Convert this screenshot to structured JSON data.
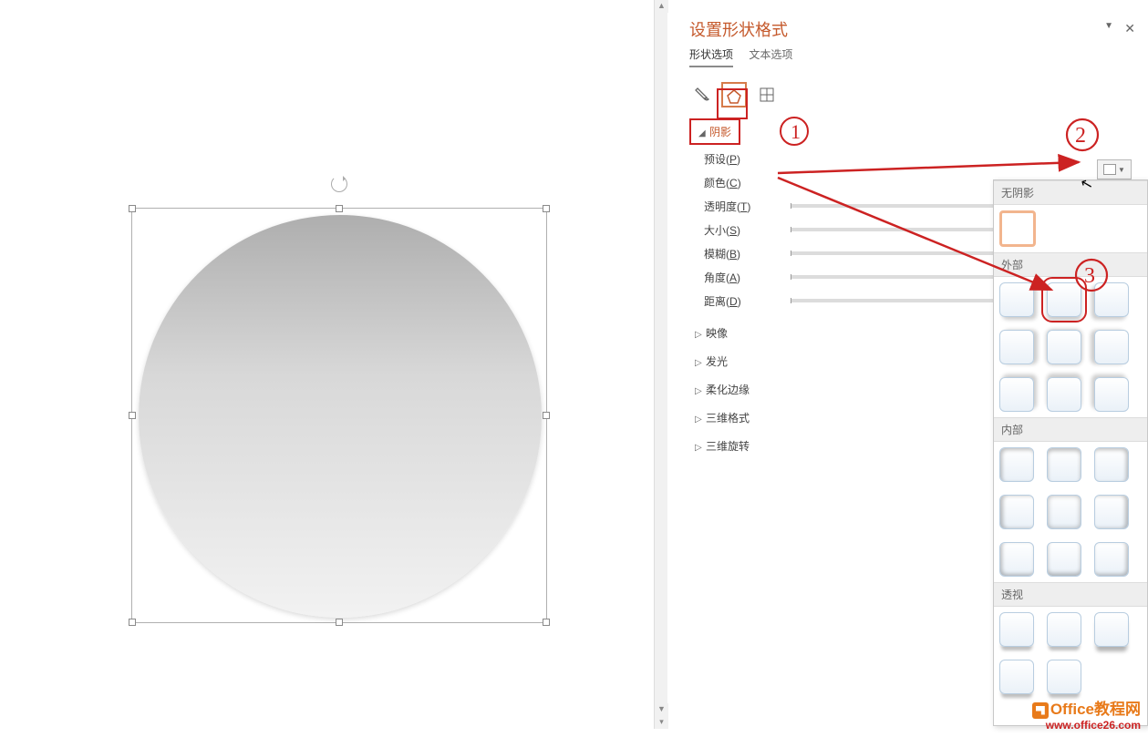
{
  "pane": {
    "title": "设置形状格式",
    "tabs": {
      "shape": "形状选项",
      "text": "文本选项"
    }
  },
  "sections": {
    "shadow": "阴影",
    "reflection": "映像",
    "glow": "发光",
    "softEdges": "柔化边缘",
    "format3d": "三维格式",
    "rotate3d": "三维旋转"
  },
  "shadow": {
    "preset": "预设",
    "presetKey": "P",
    "color": "颜色",
    "colorKey": "C",
    "transparency": "透明度",
    "transparencyKey": "T",
    "size": "大小",
    "sizeKey": "S",
    "blur": "模糊",
    "blurKey": "B",
    "angle": "角度",
    "angleKey": "A",
    "distance": "距离",
    "distanceKey": "D"
  },
  "gallery": {
    "noShadow": "无阴影",
    "outer": "外部",
    "inner": "内部",
    "perspective": "透视"
  },
  "watermark": {
    "brand1a": "Office",
    "brand1b": "教程网",
    "url": "www.office26.com"
  }
}
